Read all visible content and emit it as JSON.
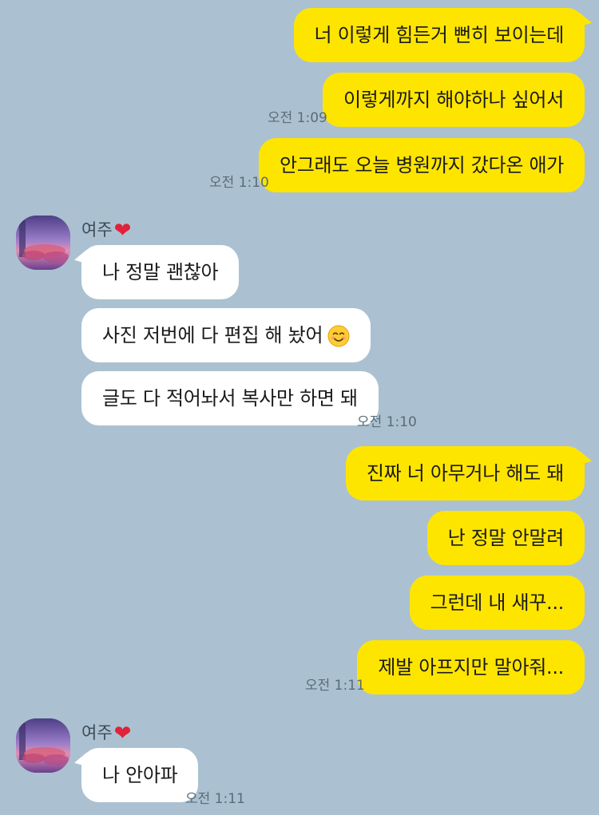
{
  "colors": {
    "background": "#abc1d1",
    "outgoing_bubble": "#fee500",
    "incoming_bubble": "#ffffff",
    "heart": "#e0223a"
  },
  "messages_out_1": [
    "너 이렇게 힘든거 뻔히 보이는데",
    "이렇게까지 해야하나 싶어서",
    "안그래도 오늘 병원까지 갔다온 애가"
  ],
  "time_out_1a": "오전 1:09",
  "time_out_1b": "오전 1:10",
  "group_in_1": {
    "sender": "여주",
    "heart_icon": "❤",
    "messages": [
      "나 정말 괜찮아",
      "사진 저번에 다 편집 해 놨어",
      "글도 다 적어놔서 복사만 하면 돼"
    ],
    "emoji_icon": "smiling-face-icon",
    "time": "오전 1:10"
  },
  "messages_out_2": [
    "진짜 너 아무거나 해도 돼",
    "난 정말 안말려",
    "그런데 내 새꾸...",
    "제발 아프지만 말아줘..."
  ],
  "time_out_2": "오전 1:11",
  "group_in_2": {
    "sender": "여주",
    "heart_icon": "❤",
    "messages": [
      "나 안아파"
    ],
    "time": "오전 1:11"
  }
}
